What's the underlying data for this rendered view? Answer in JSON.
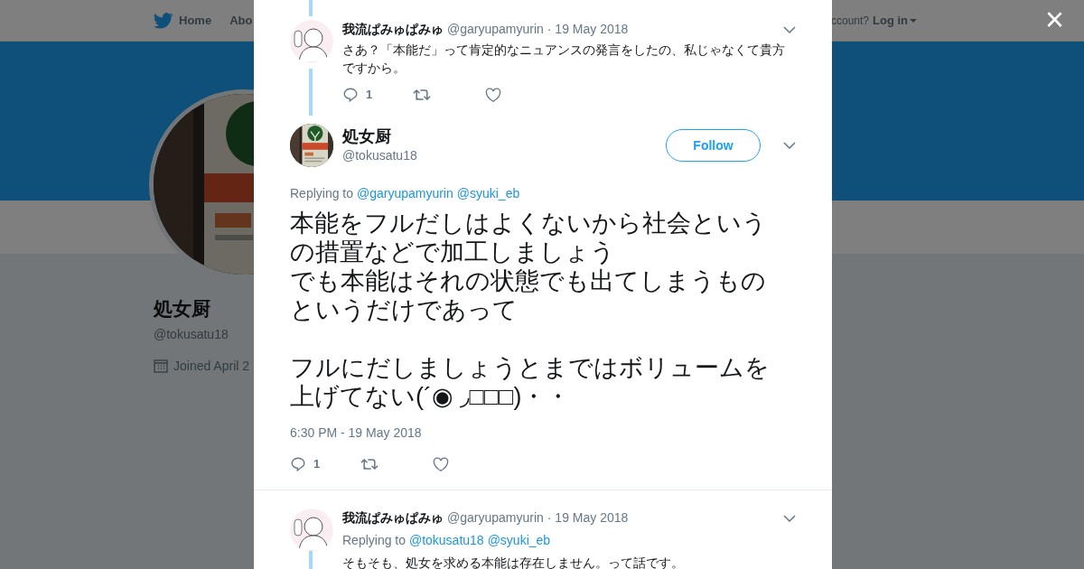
{
  "nav": {
    "home": "Home",
    "about": "Abo",
    "account_prompt": "ccount?",
    "login": "Log in"
  },
  "profile": {
    "name": "処女厨",
    "handle": "@tokusatu18",
    "joined": "Joined April 2"
  },
  "close": "×",
  "parent_tweet": {
    "name": "我流ぱみゅぱみゅ",
    "handle": "@garyupamyurin",
    "date": "· 19 May 2018",
    "text": "さあ？「本能だ」って肯定的なニュアンスの発言をしたの、私じゃなくて貴方ですから。",
    "replies": "1"
  },
  "main_tweet": {
    "name": "処女厨",
    "handle": "@tokusatu18",
    "follow": "Follow",
    "replying_label": "Replying to",
    "mentions": [
      "@garyupamyurin",
      "@syuki_eb"
    ],
    "paragraphs": [
      [
        "本能をフルだしはよくないから社会というの措置などで加工しましょう",
        "でも本能はそれの状態でも出てしまうものというだけであって"
      ],
      [
        "フルにだしましょうとまではボリュームを上げてない(´◉ ◞□□□)・・"
      ]
    ],
    "timestamp": "6:30 PM - 19 May 2018",
    "replies": "1"
  },
  "reply_tweet": {
    "name": "我流ぱみゅぱみゅ",
    "handle": "@garyupamyurin",
    "date": "· 19 May 2018",
    "replying_label": "Replying to",
    "mentions": [
      "@tokusatu18",
      "@syuki_eb"
    ],
    "text": "そもそも、処女を求める本能は存在しません。って話です。"
  }
}
